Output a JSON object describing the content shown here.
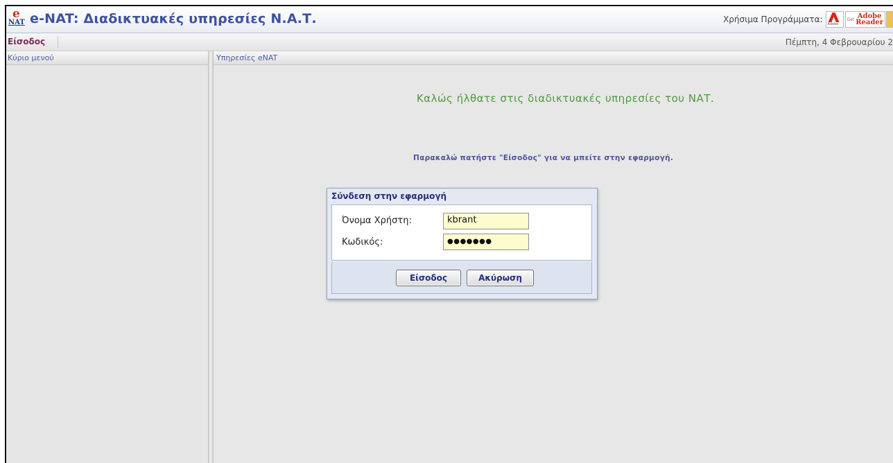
{
  "header": {
    "logo_letter": "e",
    "logo_abbr": "NAT",
    "title": "e-NAT: Διαδικτυακές υπηρεσίες Ν.Α.Τ.",
    "programs_label": "Χρήσιμα Προγράμματα:",
    "adobe_icon": "adobe-logo-icon",
    "reader_badge_get": "Get",
    "reader_badge_line1": "Adobe",
    "reader_badge_line2": "Reader"
  },
  "toolbar": {
    "login_link": "Είσοδος",
    "date": "Πέμπτη, 4 Φεβρουαρίου 2"
  },
  "left_panel": {
    "title": "Κύριο μενού"
  },
  "main_panel": {
    "title": "Υπηρεσίες eNAT",
    "welcome": "Καλώς ήλθατε στις διαδικτυακές υπηρεσίες του ΝΑΤ.",
    "instruction": "Παρακαλώ πατήστε \"Είσοδος\" για να μπείτε στην εφαρμογή."
  },
  "login_dialog": {
    "title": "Σύνδεση στην εφαρμογή",
    "username_label": "Όνομα Χρήστη:",
    "username_value": "kbrant",
    "password_label": "Κωδικός:",
    "password_value": "●●●●●●●",
    "login_button": "Είσοδος",
    "cancel_button": "Ακύρωση"
  },
  "colors": {
    "title_blue": "#3d52a1",
    "welcome_green": "#4f9a3f",
    "input_yellow": "#fefccf"
  }
}
